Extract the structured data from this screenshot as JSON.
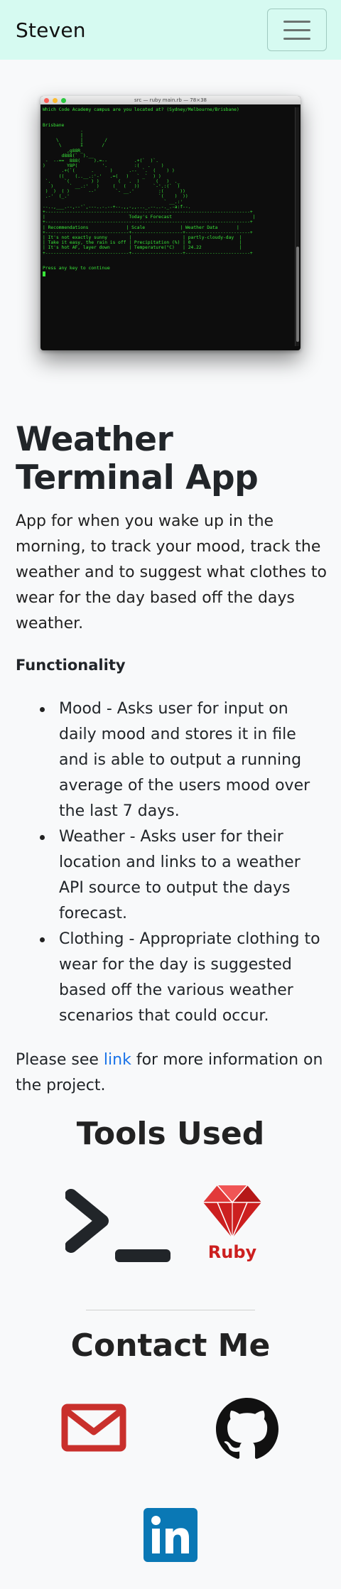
{
  "nav": {
    "brand": "Steven"
  },
  "terminal": {
    "title": "src — ruby main.rb — 78×38",
    "question": "Which Code Academy campus are you located at? (Sydney/Melbourne/Brisbane)",
    "answer": "Brisbane",
    "forecast_title": "Today's Forecast",
    "headers": [
      "Recommendations",
      "Scale",
      "Weather Data"
    ],
    "rows": [
      [
        "It's not exactly sunny",
        "",
        "partly-cloudy-day"
      ],
      [
        "Take it easy, the rain is off",
        "Precipitation (%)",
        "0"
      ],
      [
        "It's hot AF, layer down",
        "Temperature(°C)",
        "24.22"
      ]
    ],
    "prompt": "Press any key to continue"
  },
  "main": {
    "title": "Weather Terminal App",
    "description": "App for when you wake up in the morning, to track your mood, track the weather and to suggest what clothes to wear for the day based off the days weather.",
    "functionality_heading": "Functionality",
    "features": [
      "Mood - Asks user for input on daily mood and stores it in file and is able to output a running average of the users mood over the last 7 days.",
      "Weather - Asks user for their location and links to a weather API source to output the days forecast.",
      "Clothing - Appropriate clothing to wear for the day is suggested based off the various weather scenarios that could occur."
    ],
    "see_prefix": "Please see ",
    "see_link": "link",
    "see_suffix": " for more information on the project."
  },
  "tools": {
    "title": "Tools Used",
    "icons": [
      "terminal-icon",
      "ruby-logo"
    ],
    "ruby_label": "Ruby"
  },
  "contact": {
    "title": "Contact Me",
    "icons": [
      "mail-icon",
      "github-icon",
      "linkedin-icon"
    ]
  },
  "colors": {
    "navbar_bg": "#d6faf1",
    "link": "#1a73e8",
    "ruby_red": "#cc1f1f",
    "mail_red": "#c9302c",
    "linkedin_blue": "#0a78b5",
    "terminal_green": "#39e639"
  }
}
